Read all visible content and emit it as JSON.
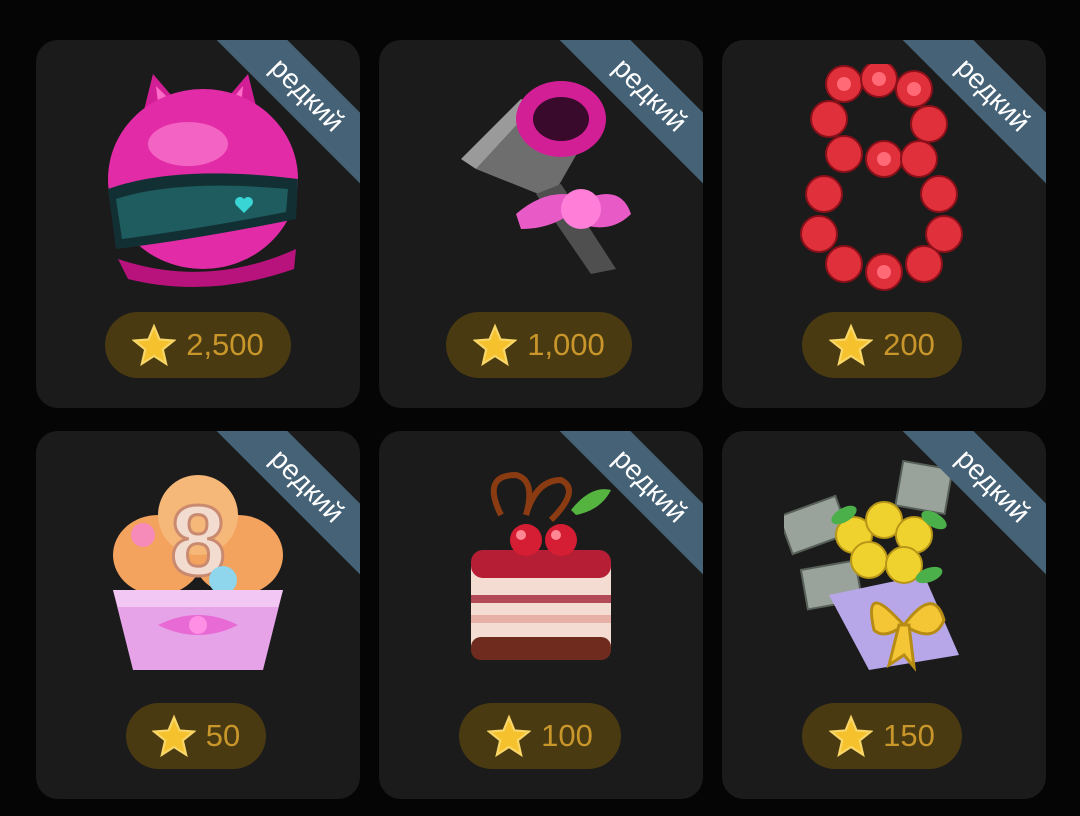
{
  "gifts": [
    {
      "badge": "редкий",
      "price": "2,500",
      "item_icon": "cat-ear-helmet-icon",
      "price_icon": "star-icon"
    },
    {
      "badge": "редкий",
      "price": "1,000",
      "item_icon": "hair-dryer-icon",
      "price_icon": "star-icon"
    },
    {
      "badge": "редкий",
      "price": "200",
      "item_icon": "rose-number-eight-icon",
      "price_icon": "star-icon"
    },
    {
      "badge": "редкий",
      "price": "50",
      "item_icon": "cupcake-icon",
      "price_icon": "star-icon"
    },
    {
      "badge": "редкий",
      "price": "100",
      "item_icon": "cherry-cake-icon",
      "price_icon": "star-icon"
    },
    {
      "badge": "редкий",
      "price": "150",
      "item_icon": "money-bouquet-icon",
      "price_icon": "star-icon"
    }
  ],
  "colors": {
    "background": "#050505",
    "card": "#1b1b1b",
    "ribbon": "#456277",
    "price_pill": "#4a3a11",
    "price_text": "#c8962a",
    "star": "#f5c22e"
  }
}
